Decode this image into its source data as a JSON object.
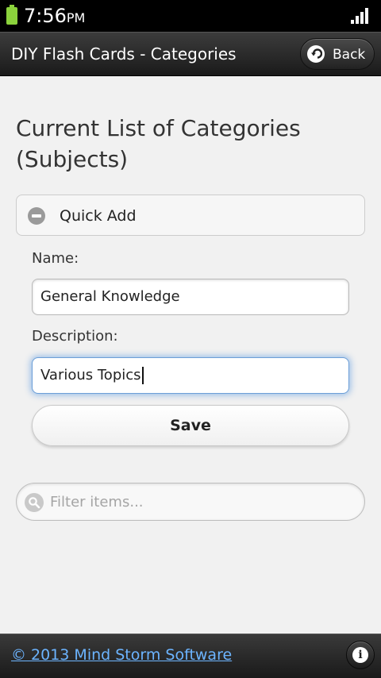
{
  "status_bar": {
    "time": "7:56",
    "ampm": "PM",
    "battery_icon": "battery-icon",
    "signal_icon": "signal-icon"
  },
  "header": {
    "title": "DIY Flash Cards - Categories",
    "back_label": "Back",
    "back_icon": "back-arrow-icon"
  },
  "main": {
    "page_title": "Current List of Categories (Subjects)",
    "quick_add": {
      "label": "Quick Add",
      "icon": "minus-icon",
      "name_label": "Name:",
      "name_value": "General Knowledge",
      "description_label": "Description:",
      "description_value": "Various Topics",
      "save_label": "Save"
    },
    "filter": {
      "placeholder": "Filter items...",
      "icon": "search-icon"
    }
  },
  "footer": {
    "link_text": "© 2013 Mind Storm Software",
    "info_icon": "info-icon",
    "link_color": "#6cb4ff"
  }
}
